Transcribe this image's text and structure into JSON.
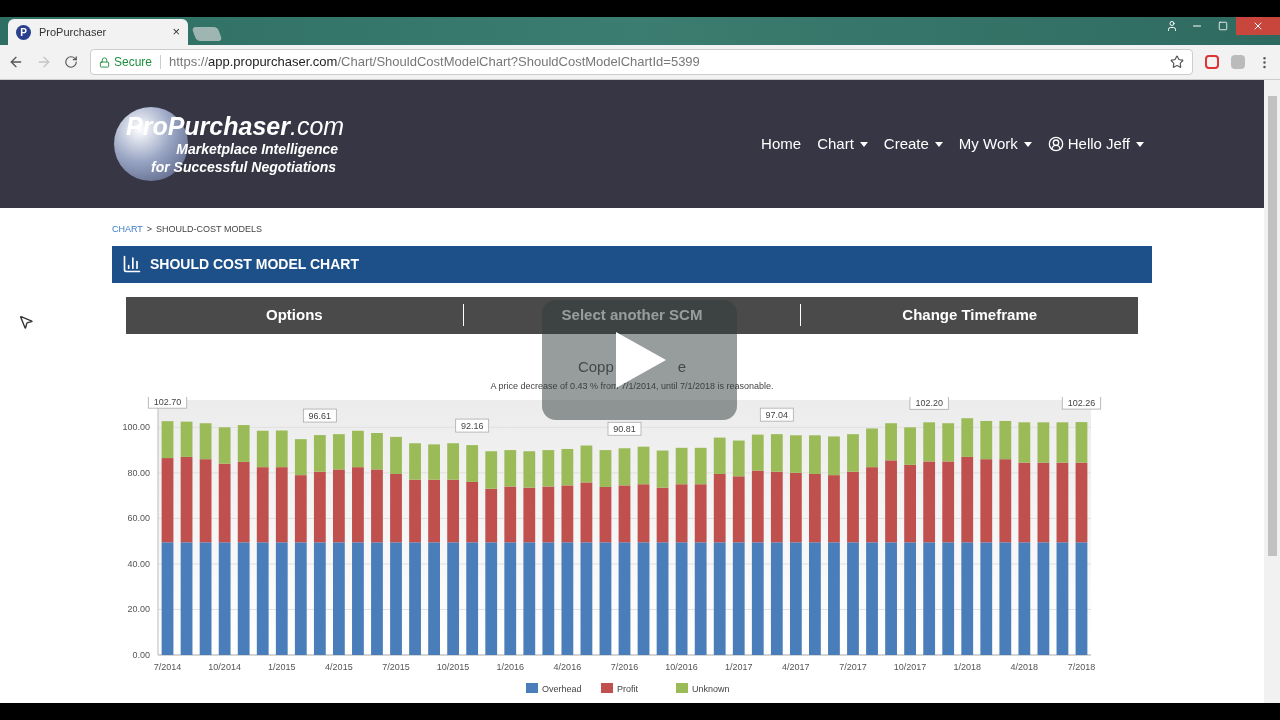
{
  "browser": {
    "tabs": [
      {
        "title": "ProPurchaser",
        "favicon": "P",
        "selected": true,
        "close": "×"
      },
      {
        "selected": false
      }
    ],
    "address": {
      "security": "Secure",
      "scheme": "https://",
      "host": "app.propurchaser.com",
      "path": "/Chart/ShouldCostModelChart?ShouldCostModelChartId=5399"
    }
  },
  "header": {
    "logo": {
      "brand": "ProPurchaser",
      "suffix": ".com",
      "tagline_1": "Marketplace Intelligence",
      "tagline_2": "for Successful Negotiations"
    },
    "nav": [
      {
        "label": "Home",
        "dropdown": false,
        "kind": "link"
      },
      {
        "label": "Chart",
        "dropdown": true,
        "kind": "link"
      },
      {
        "label": "Create",
        "dropdown": true,
        "kind": "link"
      },
      {
        "label": "My Work",
        "dropdown": true,
        "kind": "link"
      },
      {
        "label": "Hello Jeff",
        "dropdown": true,
        "kind": "user"
      }
    ]
  },
  "breadcrumb": [
    {
      "label": "CHART",
      "kind": "link"
    },
    {
      "label": ">",
      "kind": "separator"
    },
    {
      "label": "SHOULD-COST MODELS",
      "kind": "current"
    }
  ],
  "panel_title": "SHOULD COST MODEL CHART",
  "toolbar": [
    "Options",
    "Select another SCM",
    "Change Timeframe"
  ],
  "chart": {
    "title_start": "Copp",
    "title_end": "e",
    "subtitle": "A price decrease of 0.43 % from 7/1/2014, until 7/1/2018 is reasonable.",
    "chart_data": {
      "type": "bar",
      "stacked": true,
      "grid": true,
      "legend": true,
      "ylim": [
        0,
        112
      ],
      "yticks": [
        {
          "value": 0,
          "label": "0.00"
        },
        {
          "value": 20,
          "label": "20.00"
        },
        {
          "value": 40,
          "label": "40.00"
        },
        {
          "value": 60,
          "label": "60.00"
        },
        {
          "value": 80,
          "label": "80.00"
        },
        {
          "value": 100,
          "label": "100.00"
        }
      ],
      "categories": [
        "7/2014",
        null,
        null,
        "10/2014",
        null,
        null,
        "1/2015",
        null,
        null,
        "4/2015",
        null,
        null,
        "7/2015",
        null,
        null,
        "10/2015",
        null,
        null,
        "1/2016",
        null,
        null,
        "4/2016",
        null,
        null,
        "7/2016",
        null,
        null,
        "10/2016",
        null,
        null,
        "1/2017",
        null,
        null,
        "4/2017",
        null,
        null,
        "7/2017",
        null,
        null,
        "10/2017",
        null,
        null,
        "1/2018",
        null,
        null,
        "4/2018",
        null,
        null,
        "7/2018"
      ],
      "value_labels": [
        "102.70",
        null,
        null,
        null,
        null,
        null,
        null,
        null,
        "96.61",
        null,
        null,
        null,
        null,
        null,
        null,
        null,
        "92.16",
        null,
        null,
        null,
        null,
        null,
        null,
        null,
        "90.81",
        null,
        null,
        null,
        null,
        null,
        null,
        null,
        "97.04",
        null,
        null,
        null,
        null,
        null,
        null,
        null,
        "102.20",
        null,
        null,
        null,
        null,
        null,
        null,
        null,
        "102.26"
      ],
      "series": [
        {
          "name": "Overhead",
          "color": "#4a7ebb",
          "values": [
            49.5,
            49.5,
            49.5,
            49.5,
            49.5,
            49.5,
            49.5,
            49.5,
            49.5,
            49.5,
            49.5,
            49.5,
            49.5,
            49.5,
            49.5,
            49.5,
            49.5,
            49.5,
            49.5,
            49.5,
            49.5,
            49.5,
            49.5,
            49.5,
            49.5,
            49.5,
            49.5,
            49.5,
            49.5,
            49.5,
            49.5,
            49.5,
            49.5,
            49.5,
            49.5,
            49.5,
            49.5,
            49.5,
            49.5,
            49.5,
            49.5,
            49.5,
            49.5,
            49.5,
            49.5,
            49.5,
            49.5,
            49.5,
            49.5
          ]
        },
        {
          "name": "Profit",
          "color": "#c0504d",
          "values": [
            37,
            37.5,
            36.5,
            34.5,
            35.3,
            33,
            33,
            29.5,
            31,
            32,
            33,
            32,
            30,
            27.5,
            27.5,
            27.5,
            26.5,
            23.5,
            24.5,
            24,
            24.5,
            25,
            26.3,
            24.3,
            25,
            25.5,
            24,
            25.5,
            25.5,
            30,
            29,
            31.5,
            31,
            30.5,
            30,
            29.5,
            31,
            33,
            36,
            34,
            35.5,
            35.5,
            37.5,
            36.5,
            36.5,
            35,
            35,
            35,
            35
          ]
        },
        {
          "name": "Unknown",
          "color": "#9bbb59",
          "values": [
            16.2,
            15.5,
            15.8,
            16,
            16.2,
            16,
            16.1,
            15.8,
            16.1,
            15.5,
            16,
            16,
            16.3,
            16,
            15.5,
            16,
            16.2,
            16.5,
            16,
            16,
            16,
            16,
            16.2,
            16.2,
            16.3,
            16.5,
            16.3,
            16,
            16,
            16,
            15.7,
            15.8,
            16.5,
            16.5,
            17,
            17,
            16.5,
            17,
            16.3,
            16.5,
            17.2,
            16.8,
            17,
            16.8,
            16.8,
            17.7,
            17.7,
            17.7,
            17.8
          ]
        }
      ]
    }
  },
  "video": {
    "paused": true
  }
}
